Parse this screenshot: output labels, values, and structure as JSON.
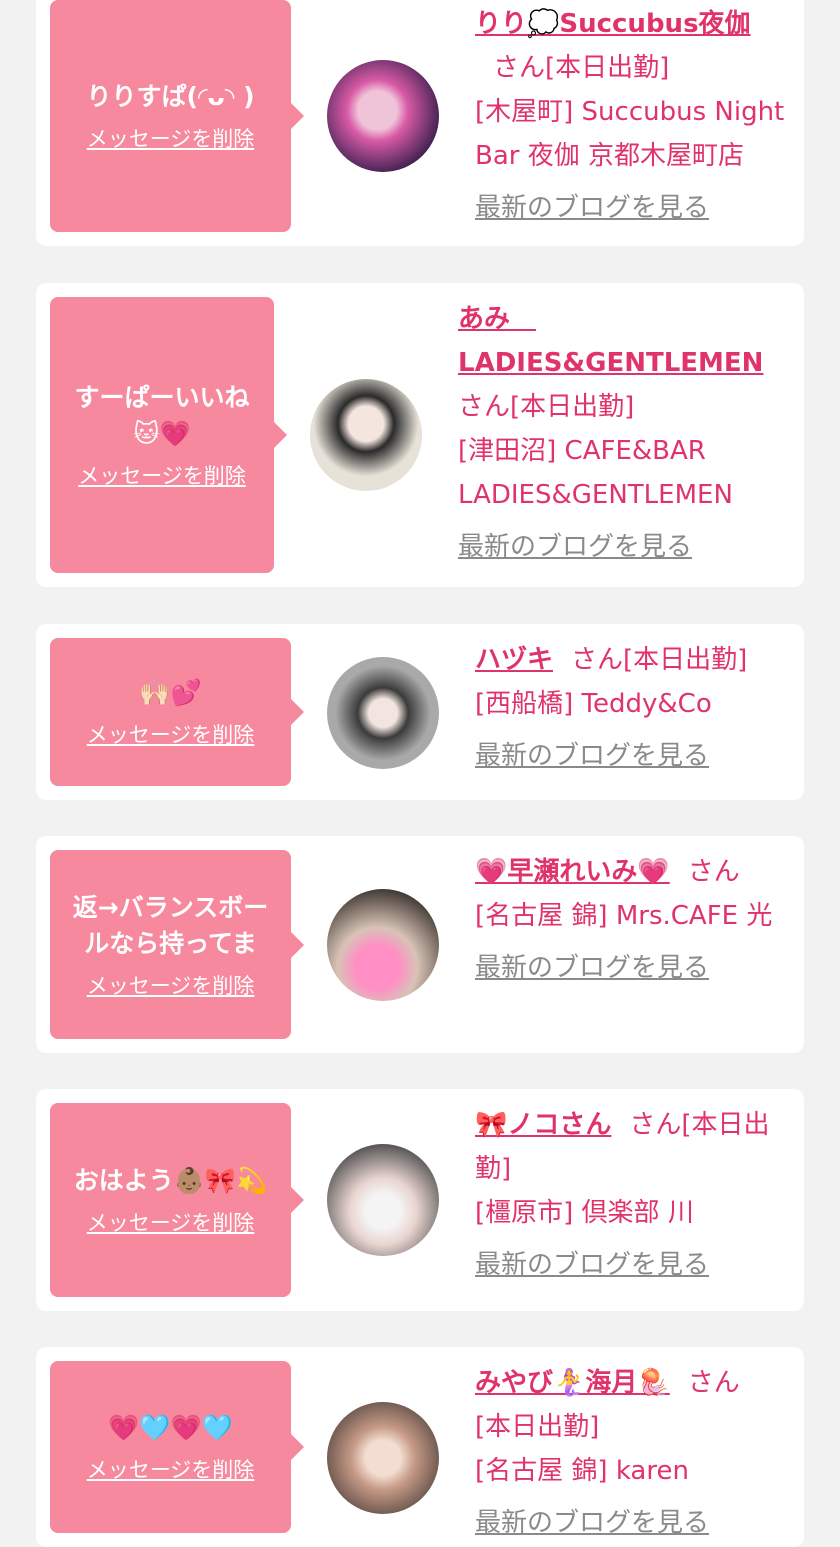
{
  "cards": [
    {
      "message": "りりすぱ(◜ᴗ◝ )",
      "delete_label": "メッセージを削除",
      "name": "りり💭Succubus夜伽",
      "honorific": "さん",
      "status": "[本日出勤]",
      "shop": "[木屋町] Succubus Night Bar 夜伽 京都木屋町店",
      "blog_link": "最新のブログを見る",
      "avatar_colors": [
        "#3a1f4e",
        "#d85aa6"
      ]
    },
    {
      "message": "すーぱーいいね🐱💗",
      "delete_label": "メッセージを削除",
      "name": "あみ　LADIES&GENTLEMEN",
      "honorific": "さん",
      "status": "[本日出勤]",
      "shop": "[津田沼] CAFE&BAR LADIES&GENTLEMEN",
      "blog_link": "最新のブログを見る",
      "avatar_colors": [
        "#e7e2d8",
        "#2a2a2a"
      ]
    },
    {
      "message": "🙌🏻💕",
      "delete_label": "メッセージを削除",
      "name": "ハヅキ",
      "honorific": "さん",
      "status": "[本日出勤]",
      "shop": "[西船橋] Teddy&Co",
      "blog_link": "最新のブログを見る",
      "avatar_colors": [
        "#7b7b7b",
        "#dedede"
      ]
    },
    {
      "message": "返→バランスボールなら持ってま",
      "delete_label": "メッセージを削除",
      "name": "💗早瀬れいみ💗",
      "honorific": "さん",
      "status": "",
      "shop": "[名古屋 錦] Mrs.CAFE 光",
      "blog_link": "最新のブログを見る",
      "avatar_colors": [
        "#b9a59a",
        "#ff8fc4"
      ]
    },
    {
      "message": "おはよう👶🏽🎀💫",
      "delete_label": "メッセージを削除",
      "name": "🎀ノコさん",
      "honorific": "さん",
      "status": "[本日出勤]",
      "shop": "[橿原市] 倶楽部 川",
      "blog_link": "最新のブログを見る",
      "avatar_colors": [
        "#4a4a4a",
        "#e9d5d0"
      ]
    },
    {
      "message": "💗🩵💗🩵",
      "delete_label": "メッセージを削除",
      "name": "みやび🧜‍♀️海月🪼",
      "honorific": "さん",
      "status": "[本日出勤]",
      "shop": "[名古屋 錦] karen",
      "blog_link": "最新のブログを見る",
      "avatar_colors": [
        "#8a6f62",
        "#e7c8bb"
      ]
    }
  ],
  "colors": {
    "accent_pink": "#e0336a",
    "bubble_pink": "#f6899e",
    "background": "#f2f2f2",
    "card": "#ffffff",
    "link_gray": "#8a8a8a"
  }
}
